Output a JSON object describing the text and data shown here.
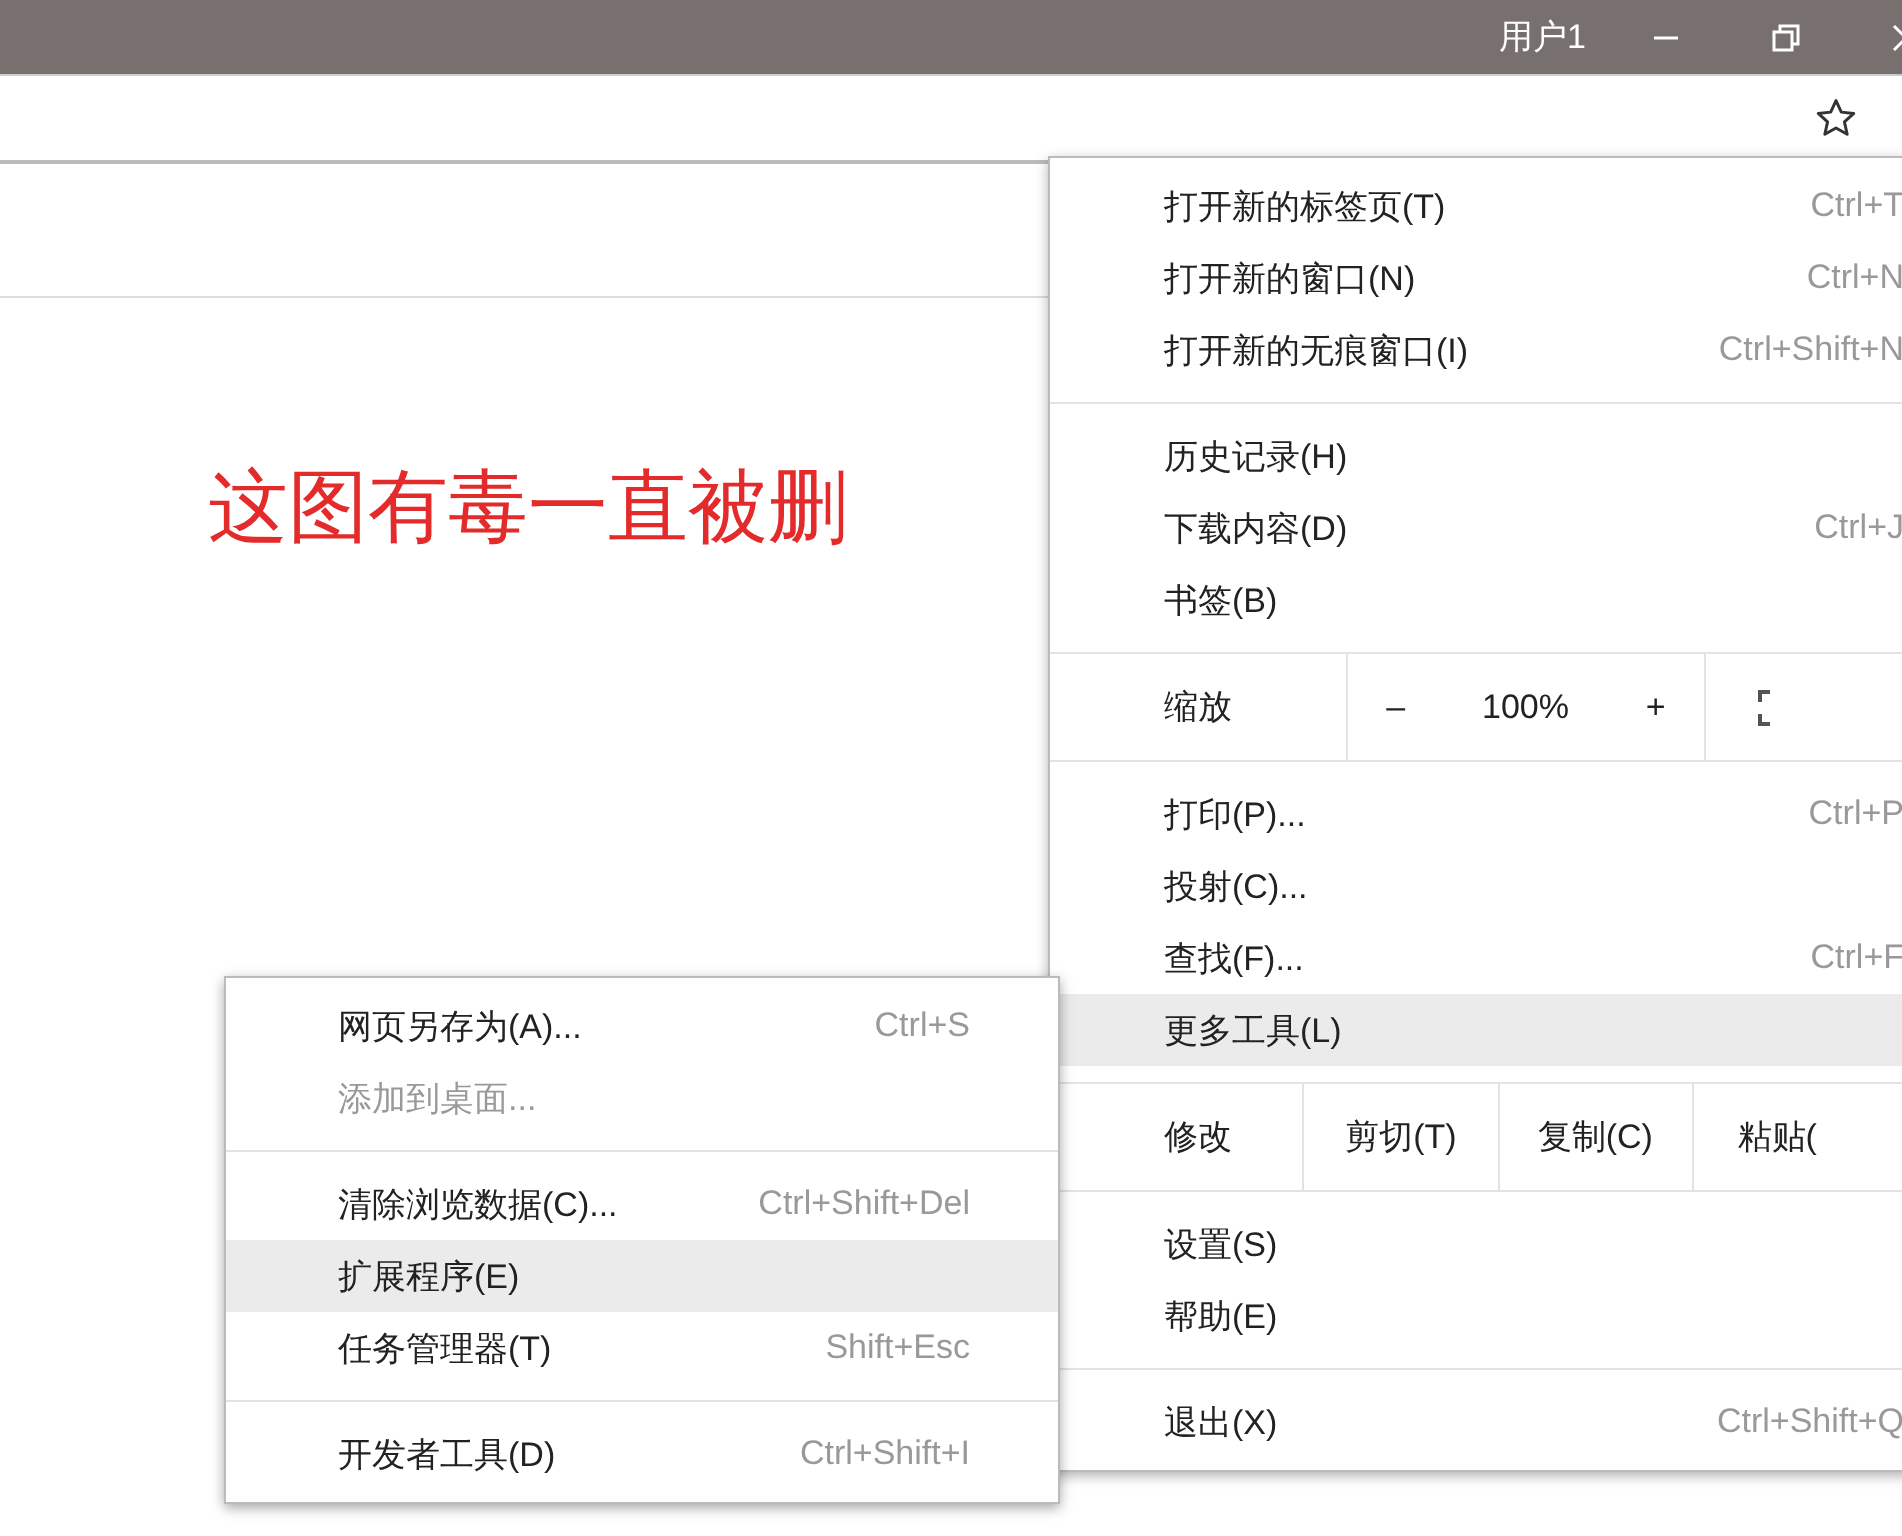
{
  "title_bar": {
    "user": "用户1"
  },
  "annotation": "这图有毒一直被删",
  "main_menu": {
    "sections": [
      {
        "items": [
          {
            "kind": "item",
            "label": "打开新的标签页(T)",
            "shortcut": "Ctrl+T",
            "highlighted": false
          },
          {
            "kind": "item",
            "label": "打开新的窗口(N)",
            "shortcut": "Ctrl+N",
            "highlighted": false
          },
          {
            "kind": "item",
            "label": "打开新的无痕窗口(I)",
            "shortcut": "Ctrl+Shift+N",
            "highlighted": false
          }
        ]
      },
      {
        "items": [
          {
            "kind": "item",
            "label": "历史记录(H)",
            "highlighted": false
          },
          {
            "kind": "item",
            "label": "下载内容(D)",
            "shortcut": "Ctrl+J",
            "highlighted": false
          },
          {
            "kind": "item",
            "label": "书签(B)",
            "highlighted": false
          }
        ]
      },
      {
        "items": [
          {
            "kind": "zoom",
            "label": "缩放",
            "minus": "–",
            "value": "100%",
            "plus": "+"
          }
        ]
      },
      {
        "items": [
          {
            "kind": "item",
            "label": "打印(P)...",
            "shortcut": "Ctrl+P",
            "highlighted": false
          },
          {
            "kind": "item",
            "label": "投射(C)...",
            "highlighted": false
          },
          {
            "kind": "item",
            "label": "查找(F)...",
            "shortcut": "Ctrl+F",
            "highlighted": false
          },
          {
            "kind": "item",
            "label": "更多工具(L)",
            "highlighted": true
          }
        ]
      },
      {
        "items": [
          {
            "kind": "edit",
            "label": "修改",
            "actions": [
              "剪切(T)",
              "复制(C)",
              "粘贴("
            ]
          }
        ]
      },
      {
        "items": [
          {
            "kind": "item",
            "label": "设置(S)",
            "highlighted": false
          },
          {
            "kind": "item",
            "label": "帮助(E)",
            "highlighted": false
          }
        ]
      },
      {
        "items": [
          {
            "kind": "item",
            "label": "退出(X)",
            "shortcut": "Ctrl+Shift+Q",
            "highlighted": false
          }
        ]
      }
    ]
  },
  "submenu": {
    "sections": [
      {
        "items": [
          {
            "label": "网页另存为(A)...",
            "shortcut": "Ctrl+S",
            "highlighted": false,
            "disabled": false
          },
          {
            "label": "添加到桌面...",
            "highlighted": false,
            "disabled": true
          }
        ]
      },
      {
        "items": [
          {
            "label": "清除浏览数据(C)...",
            "shortcut": "Ctrl+Shift+Del",
            "highlighted": false,
            "disabled": false
          },
          {
            "label": "扩展程序(E)",
            "highlighted": true,
            "disabled": false
          },
          {
            "label": "任务管理器(T)",
            "shortcut": "Shift+Esc",
            "highlighted": false,
            "disabled": false
          }
        ]
      },
      {
        "items": [
          {
            "label": "开发者工具(D)",
            "shortcut": "Ctrl+Shift+I",
            "highlighted": false,
            "disabled": false
          }
        ]
      }
    ]
  }
}
